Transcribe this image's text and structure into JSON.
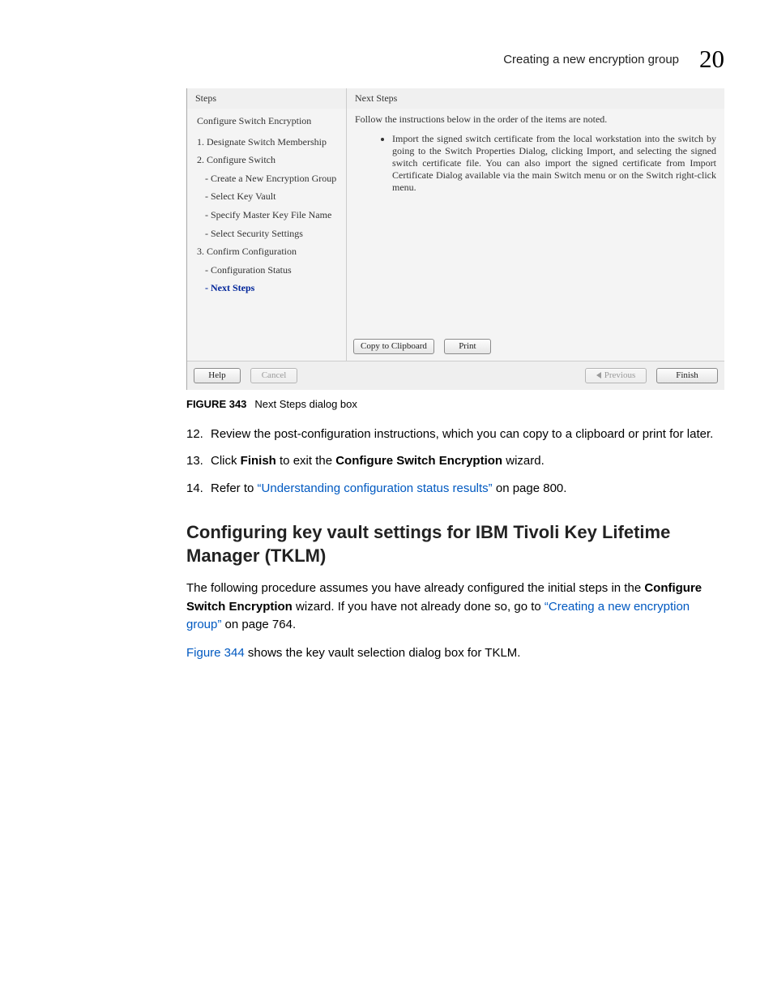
{
  "header": {
    "title": "Creating a new encryption group",
    "chapter": "20"
  },
  "dialog": {
    "steps_label": "Steps",
    "next_steps_label": "Next Steps",
    "root": "Configure Switch Encryption",
    "items": [
      "1. Designate Switch Membership",
      "2. Configure Switch",
      "- Create a New Encryption Group",
      "- Select Key Vault",
      "- Specify Master Key File Name",
      "- Select Security Settings",
      "3. Confirm Configuration",
      "- Configuration Status",
      "- Next Steps"
    ],
    "instruction": "Follow the instructions below in the order of the items are noted.",
    "bullet": "Import the signed switch certificate from the local workstation into the switch by going to the Switch Properties Dialog, clicking Import, and selecting the signed switch certificate file. You can also import the signed certificate from Import Certificate Dialog available via the main Switch menu or on the Switch right-click menu.",
    "copy_btn": "Copy to Clipboard",
    "print_btn": "Print",
    "help_btn": "Help",
    "cancel_btn": "Cancel",
    "prev_btn": "Previous",
    "finish_btn": "Finish"
  },
  "figure": {
    "label": "FIGURE 343",
    "caption": "Next Steps dialog box"
  },
  "steps": {
    "s12": "Review the post-configuration instructions, which you can copy to a clipboard or print for later.",
    "s13a": "Click ",
    "s13b": "Finish",
    "s13c": " to exit the ",
    "s13d": "Configure Switch Encryption",
    "s13e": " wizard.",
    "s14a": "Refer to ",
    "s14link": "“Understanding configuration status results”",
    "s14b": " on page 800."
  },
  "section_heading": "Configuring key vault settings for IBM Tivoli Key Lifetime Manager (TKLM)",
  "para1": {
    "a": "The following procedure assumes you have already configured the initial steps in the ",
    "b": "Configure Switch Encryption",
    "c": " wizard. If you have not already done so, go to ",
    "link": "“Creating a new encryption group”",
    "d": " on page 764."
  },
  "para2": {
    "link": "Figure 344",
    "rest": " shows the key vault selection dialog box for TKLM."
  }
}
